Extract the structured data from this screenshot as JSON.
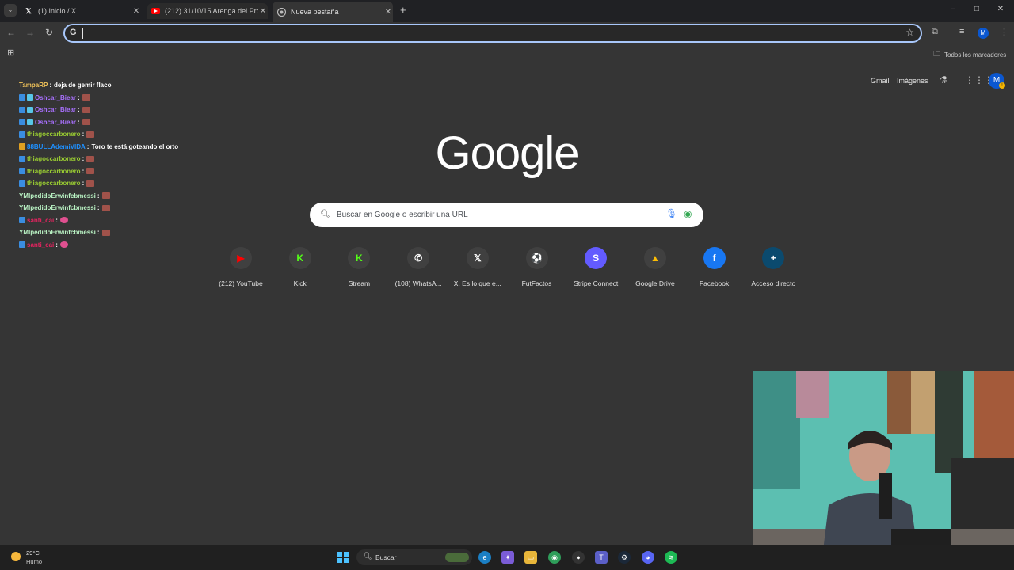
{
  "tabs": [
    {
      "title": "(1) Inicio / X",
      "icon": "x-logo-icon"
    },
    {
      "title": "(212) 31/10/15 Arenga del Pro",
      "icon": "youtube-icon"
    },
    {
      "title": "Nueva pestaña",
      "icon": "chrome-icon"
    }
  ],
  "new_tab_symbol": "+",
  "window_controls": {
    "minimize": "–",
    "maximize": "□",
    "close": "✕"
  },
  "omnibox": {
    "google_symbol": "G",
    "value": ""
  },
  "bookmarks_bar": {
    "all_bookmarks": "Todos los marcadores"
  },
  "profile_initial": "M",
  "ntp_header": {
    "gmail": "Gmail",
    "images": "Imágenes"
  },
  "logo_text": "Google",
  "search": {
    "placeholder": "Buscar en Google o escribir una URL"
  },
  "shortcuts": [
    {
      "label": "(212) YouTube",
      "glyph": "▶",
      "color": "#ff0000"
    },
    {
      "label": "Kick",
      "glyph": "K",
      "color": "#53fc18"
    },
    {
      "label": "Stream",
      "glyph": "K",
      "color": "#53fc18"
    },
    {
      "label": "(108) WhatsA...",
      "glyph": "✆",
      "color": "#ffffff"
    },
    {
      "label": "X. Es lo que e...",
      "glyph": "𝕏",
      "color": "#ffffff"
    },
    {
      "label": "FutFactos",
      "glyph": "⚽",
      "color": "#ffffff"
    },
    {
      "label": "Stripe Connect",
      "glyph": "S",
      "color": "#ffffff"
    },
    {
      "label": "Google Drive",
      "glyph": "▲",
      "color": "#fbbc04"
    },
    {
      "label": "Facebook",
      "glyph": "f",
      "color": "#ffffff"
    },
    {
      "label": "Acceso directo",
      "glyph": "+",
      "color": "#ffffff"
    }
  ],
  "chat": [
    {
      "user": "TampaRP",
      "color": "#f2c45a",
      "sep": ":",
      "message": "deja de gemir flaco",
      "emote": false
    },
    {
      "user": "Oshcar_Biear",
      "color": "#a970ff",
      "sep": ":",
      "message": "",
      "emote": true
    },
    {
      "user": "Oshcar_Biear",
      "color": "#a970ff",
      "sep": ":",
      "message": "",
      "emote": true
    },
    {
      "user": "Oshcar_Biear",
      "color": "#a970ff",
      "sep": ":",
      "message": "",
      "emote": true
    },
    {
      "user": "thiagoccarbonero",
      "color": "#9acd32",
      "sep": ":",
      "message": "",
      "emote": true
    },
    {
      "user": "88BULLAdemiVIDA",
      "color": "#1e90ff",
      "sep": ":",
      "message": "Toro te está goteando el orto",
      "emote": false
    },
    {
      "user": "thiagoccarbonero",
      "color": "#9acd32",
      "sep": ":",
      "message": "",
      "emote": true
    },
    {
      "user": "thiagoccarbonero",
      "color": "#9acd32",
      "sep": ":",
      "message": "",
      "emote": true
    },
    {
      "user": "thiagoccarbonero",
      "color": "#9acd32",
      "sep": ":",
      "message": "",
      "emote": true
    },
    {
      "user": "YMIpedidoErwinfcbmessi",
      "color": "#b9f2c3",
      "sep": ":",
      "message": "",
      "emote": true
    },
    {
      "user": "YMIpedidoErwinfcbmessi",
      "color": "#b9f2c3",
      "sep": ":",
      "message": "",
      "emote": true
    },
    {
      "user": "santi_cai",
      "color": "#e0245e",
      "sep": ":",
      "message": "",
      "emote": true
    },
    {
      "user": "YMIpedidoErwinfcbmessi",
      "color": "#b9f2c3",
      "sep": ":",
      "message": "",
      "emote": true
    },
    {
      "user": "santi_cai",
      "color": "#e0245e",
      "sep": ":",
      "message": "",
      "emote": true
    }
  ],
  "taskbar": {
    "temperature": "29°C",
    "weather": "Humo",
    "search_label": "Buscar"
  }
}
